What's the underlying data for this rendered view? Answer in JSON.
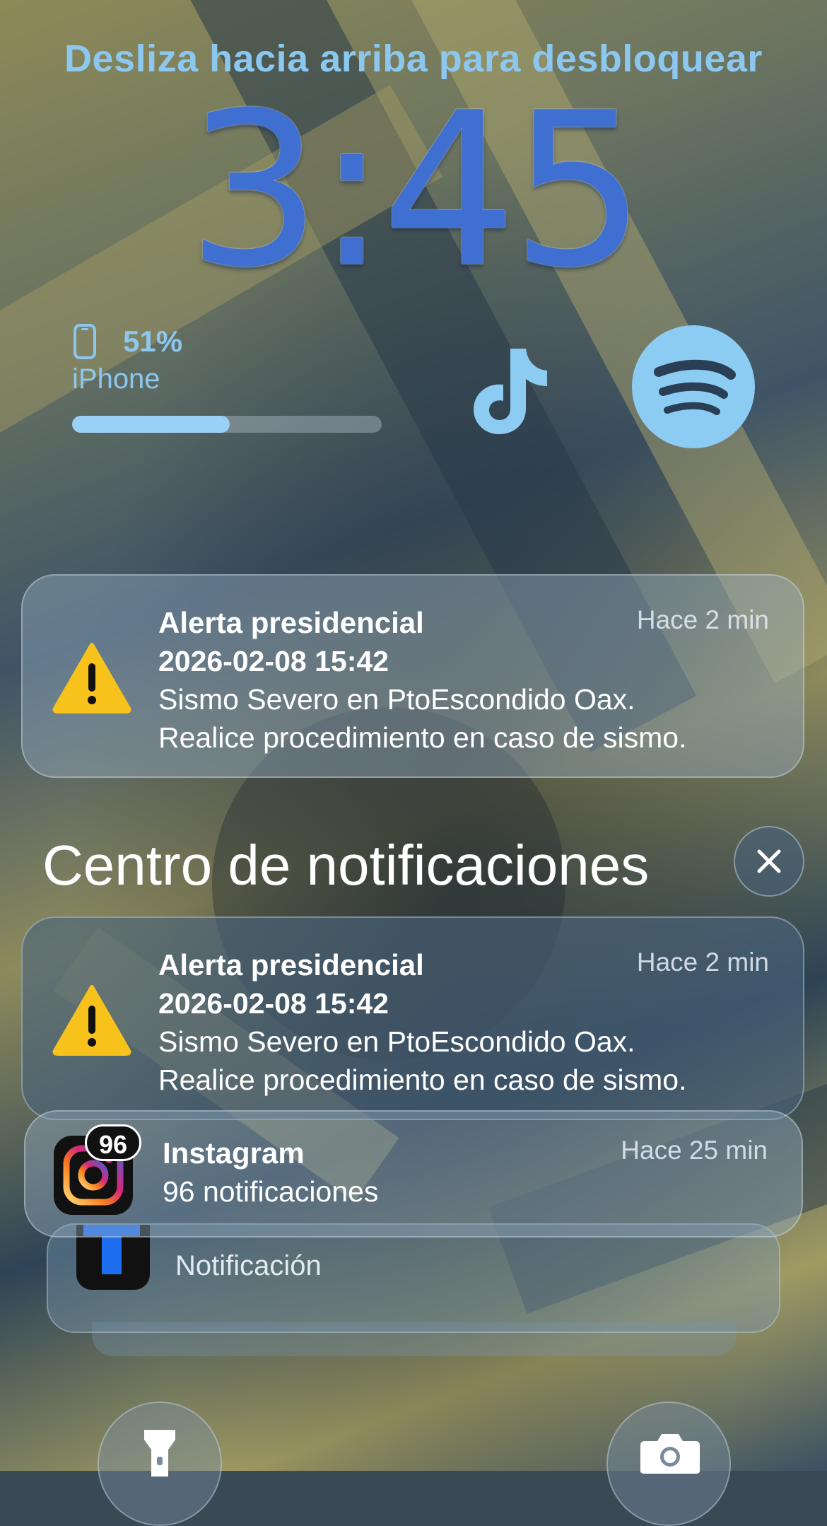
{
  "lock_screen": {
    "unlock_hint": "Desliza hacia arriba para desbloquear",
    "time": "3:45",
    "clock_color": "#3f6fd0"
  },
  "widgets": {
    "battery": {
      "percent_label": "51%",
      "level": 0.51,
      "device": "iPhone",
      "icon": "iphone-icon"
    },
    "tiktok": {
      "icon": "tiktok-icon"
    },
    "spotify": {
      "icon": "spotify-icon"
    }
  },
  "pinned_alert": {
    "title": "Alerta presidencial",
    "time": "Hace 2 min",
    "datetime": "2026-02-08 15:42",
    "line1": "Sismo Severo en PtoEscondido Oax.",
    "line2": "Realice procedimiento en caso de sismo.",
    "icon": "warning-icon"
  },
  "notification_center": {
    "title": "Centro de notificaciones",
    "close_icon": "close-icon",
    "items": [
      {
        "app": "Alerta presidencial",
        "time": "Hace 2 min",
        "datetime": "2026-02-08 15:42",
        "line1": "Sismo Severo en PtoEscondido Oax.",
        "line2": "Realice procedimiento en caso de sismo.",
        "icon": "warning-icon"
      },
      {
        "app": "Instagram",
        "time": "Hace 25 min",
        "summary": "96 notificaciones",
        "badge": "96",
        "icon": "instagram-icon"
      },
      {
        "summary": "Notificación",
        "icon": "app-icon"
      }
    ]
  },
  "quick_actions": {
    "flashlight_icon": "flashlight-icon",
    "camera_icon": "camera-icon"
  }
}
